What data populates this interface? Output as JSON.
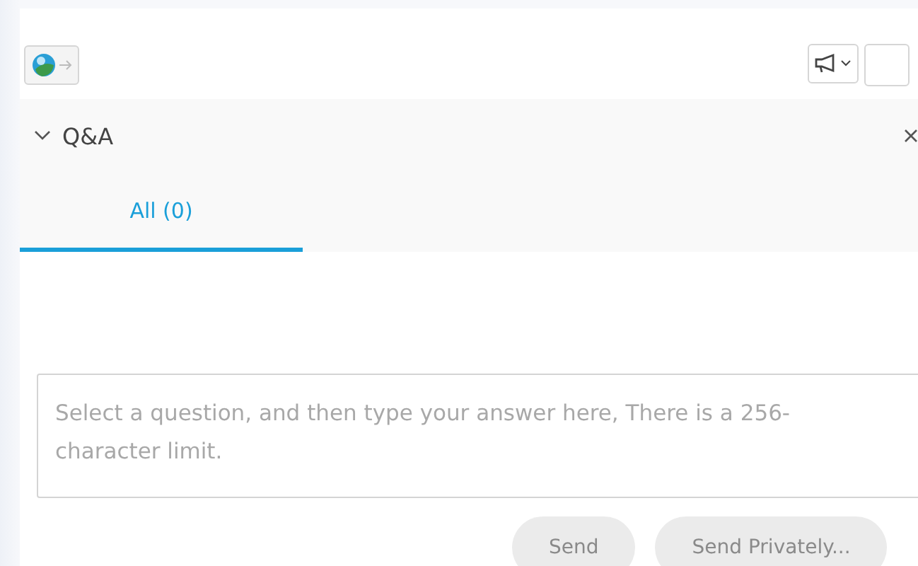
{
  "toolbar": {
    "status_button": {
      "disabled": true
    },
    "announce_button": {
      "has_menu": true
    }
  },
  "panel": {
    "title": "Q&A",
    "expanded": true
  },
  "tabs": [
    {
      "label": "All (0)",
      "selected": true
    }
  ],
  "answer": {
    "placeholder": "Select a question, and then type your answer here, There is a 256-character limit."
  },
  "buttons": [
    {
      "label": "Send",
      "disabled": true
    },
    {
      "label": "Send Privately...",
      "disabled": true
    }
  ]
}
